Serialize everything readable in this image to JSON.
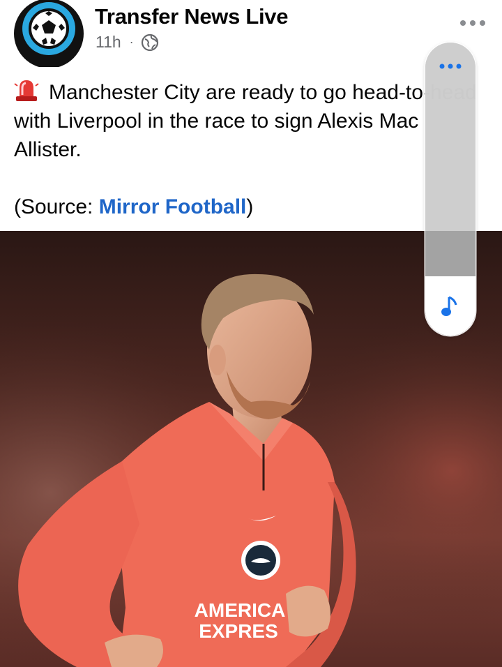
{
  "post": {
    "author": "Transfer News Live",
    "time": "11h",
    "separator": "·",
    "privacy_icon": "globe-icon",
    "more_icon": "more-horizontal-icon",
    "lead_icon": "police-light-icon",
    "body": "Manchester City are ready to go head-to-head with Liverpool in the race to sign Alexis Mac Allister.",
    "source_prefix": "(Source: ",
    "source_link": "Mirror Football",
    "source_suffix": ")",
    "photo_text_line1": "AMERICA",
    "photo_text_line2": "EXPRES"
  },
  "side_panel": {
    "more_icon": "more-horizontal-icon",
    "music_icon": "music-note-icon"
  },
  "colors": {
    "link": "#1f66c8",
    "panel_accent": "#1a73e8",
    "jersey": "#ee6b58"
  }
}
